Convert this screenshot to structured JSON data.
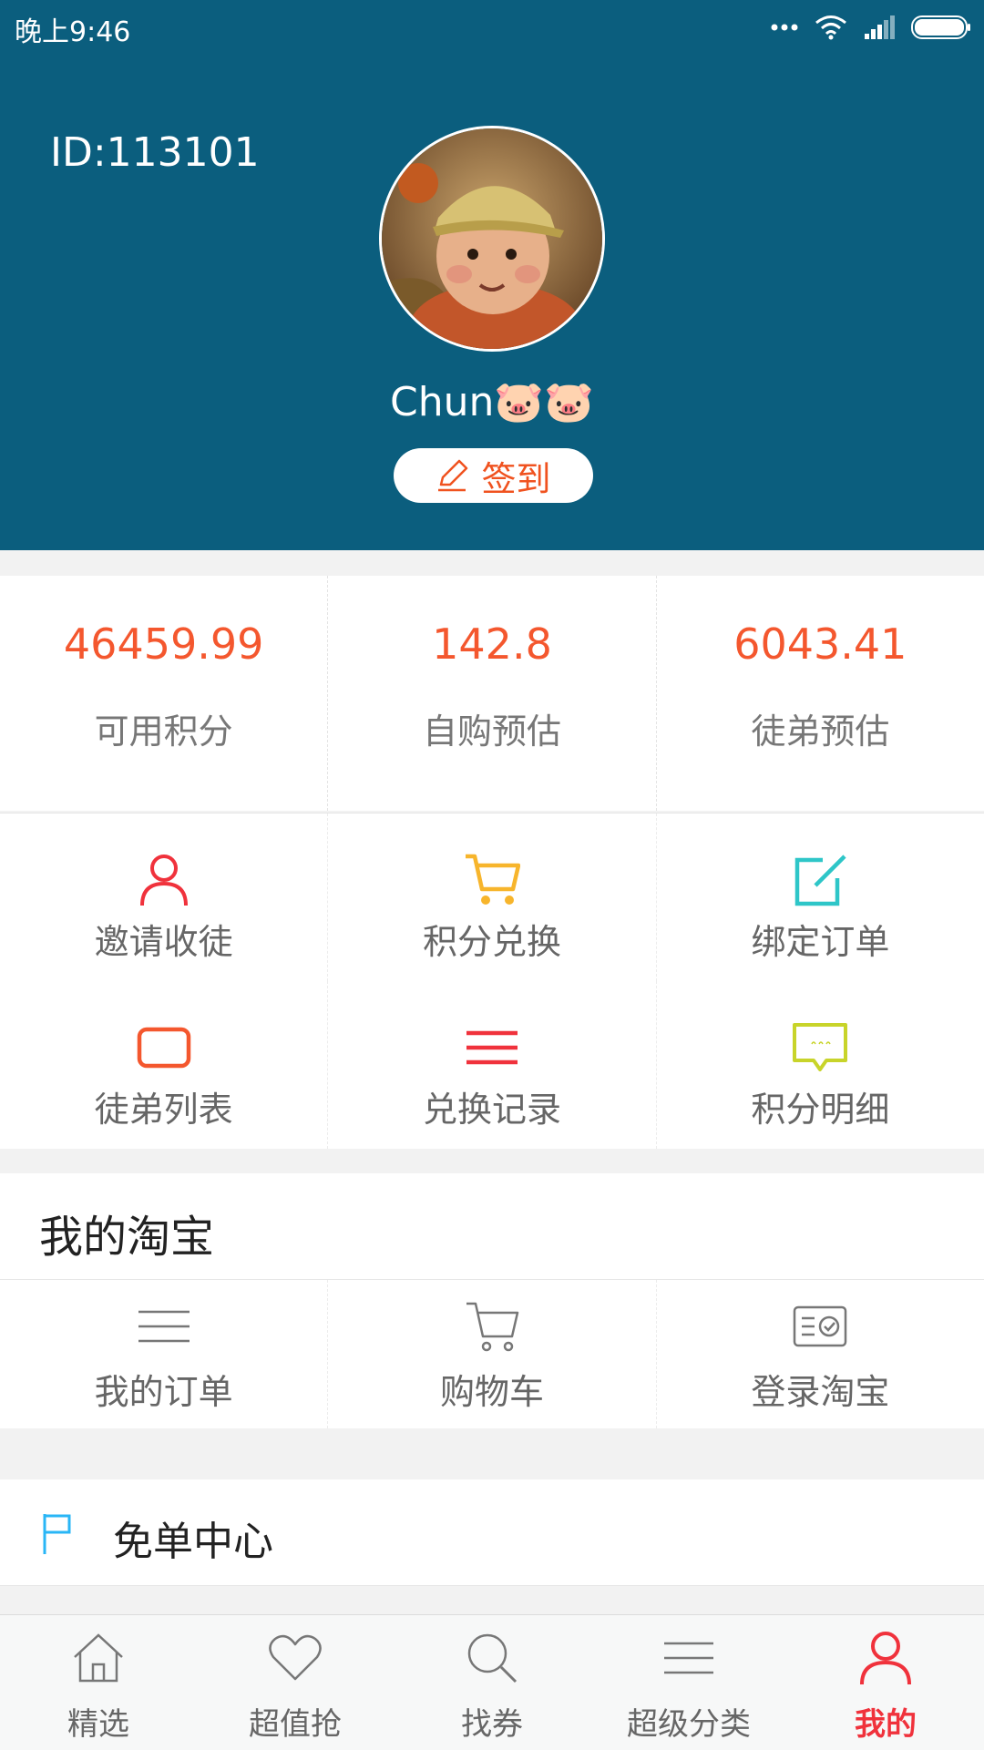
{
  "status_bar": {
    "time": "晚上9:46",
    "battery_color": "#ffffff"
  },
  "profile": {
    "id_text": "ID:113101",
    "username": "Chun🐷🐷",
    "signin_label": "签到",
    "header_color": "#0b5e7e",
    "avatar_icon": "avatar-cartoon-boy"
  },
  "stats": [
    {
      "value": "46459.99",
      "label": "可用积分"
    },
    {
      "value": "142.8",
      "label": "自购预估"
    },
    {
      "value": "6043.41",
      "label": "徒弟预估"
    }
  ],
  "actions": [
    {
      "label": "邀请收徒",
      "icon": "person-icon",
      "color": "#f0323c"
    },
    {
      "label": "积分兑换",
      "icon": "cart-icon",
      "color": "#f7b52c"
    },
    {
      "label": "绑定订单",
      "icon": "edit-icon",
      "color": "#2ec6c8"
    },
    {
      "label": "徒弟列表",
      "icon": "rectangle-icon",
      "color": "#f4572e"
    },
    {
      "label": "兑换记录",
      "icon": "list-icon",
      "color": "#f0323c"
    },
    {
      "label": "积分明细",
      "icon": "message-icon",
      "color": "#c8d42a"
    }
  ],
  "taobao": {
    "title": "我的淘宝",
    "items": [
      {
        "label": "我的订单",
        "icon": "order-list-icon"
      },
      {
        "label": "购物车",
        "icon": "cart-outline-icon"
      },
      {
        "label": "登录淘宝",
        "icon": "login-card-icon"
      }
    ]
  },
  "free_center": {
    "label": "免单中心",
    "icon": "flag-icon",
    "color": "#29b6f6"
  },
  "tabbar": {
    "active_color": "#f0323c",
    "tabs": [
      {
        "label": "精选",
        "icon": "home-icon"
      },
      {
        "label": "超值抢",
        "icon": "heart-icon"
      },
      {
        "label": "找券",
        "icon": "search-icon"
      },
      {
        "label": "超级分类",
        "icon": "menu-icon"
      },
      {
        "label": "我的",
        "icon": "user-icon",
        "active": true
      }
    ]
  }
}
